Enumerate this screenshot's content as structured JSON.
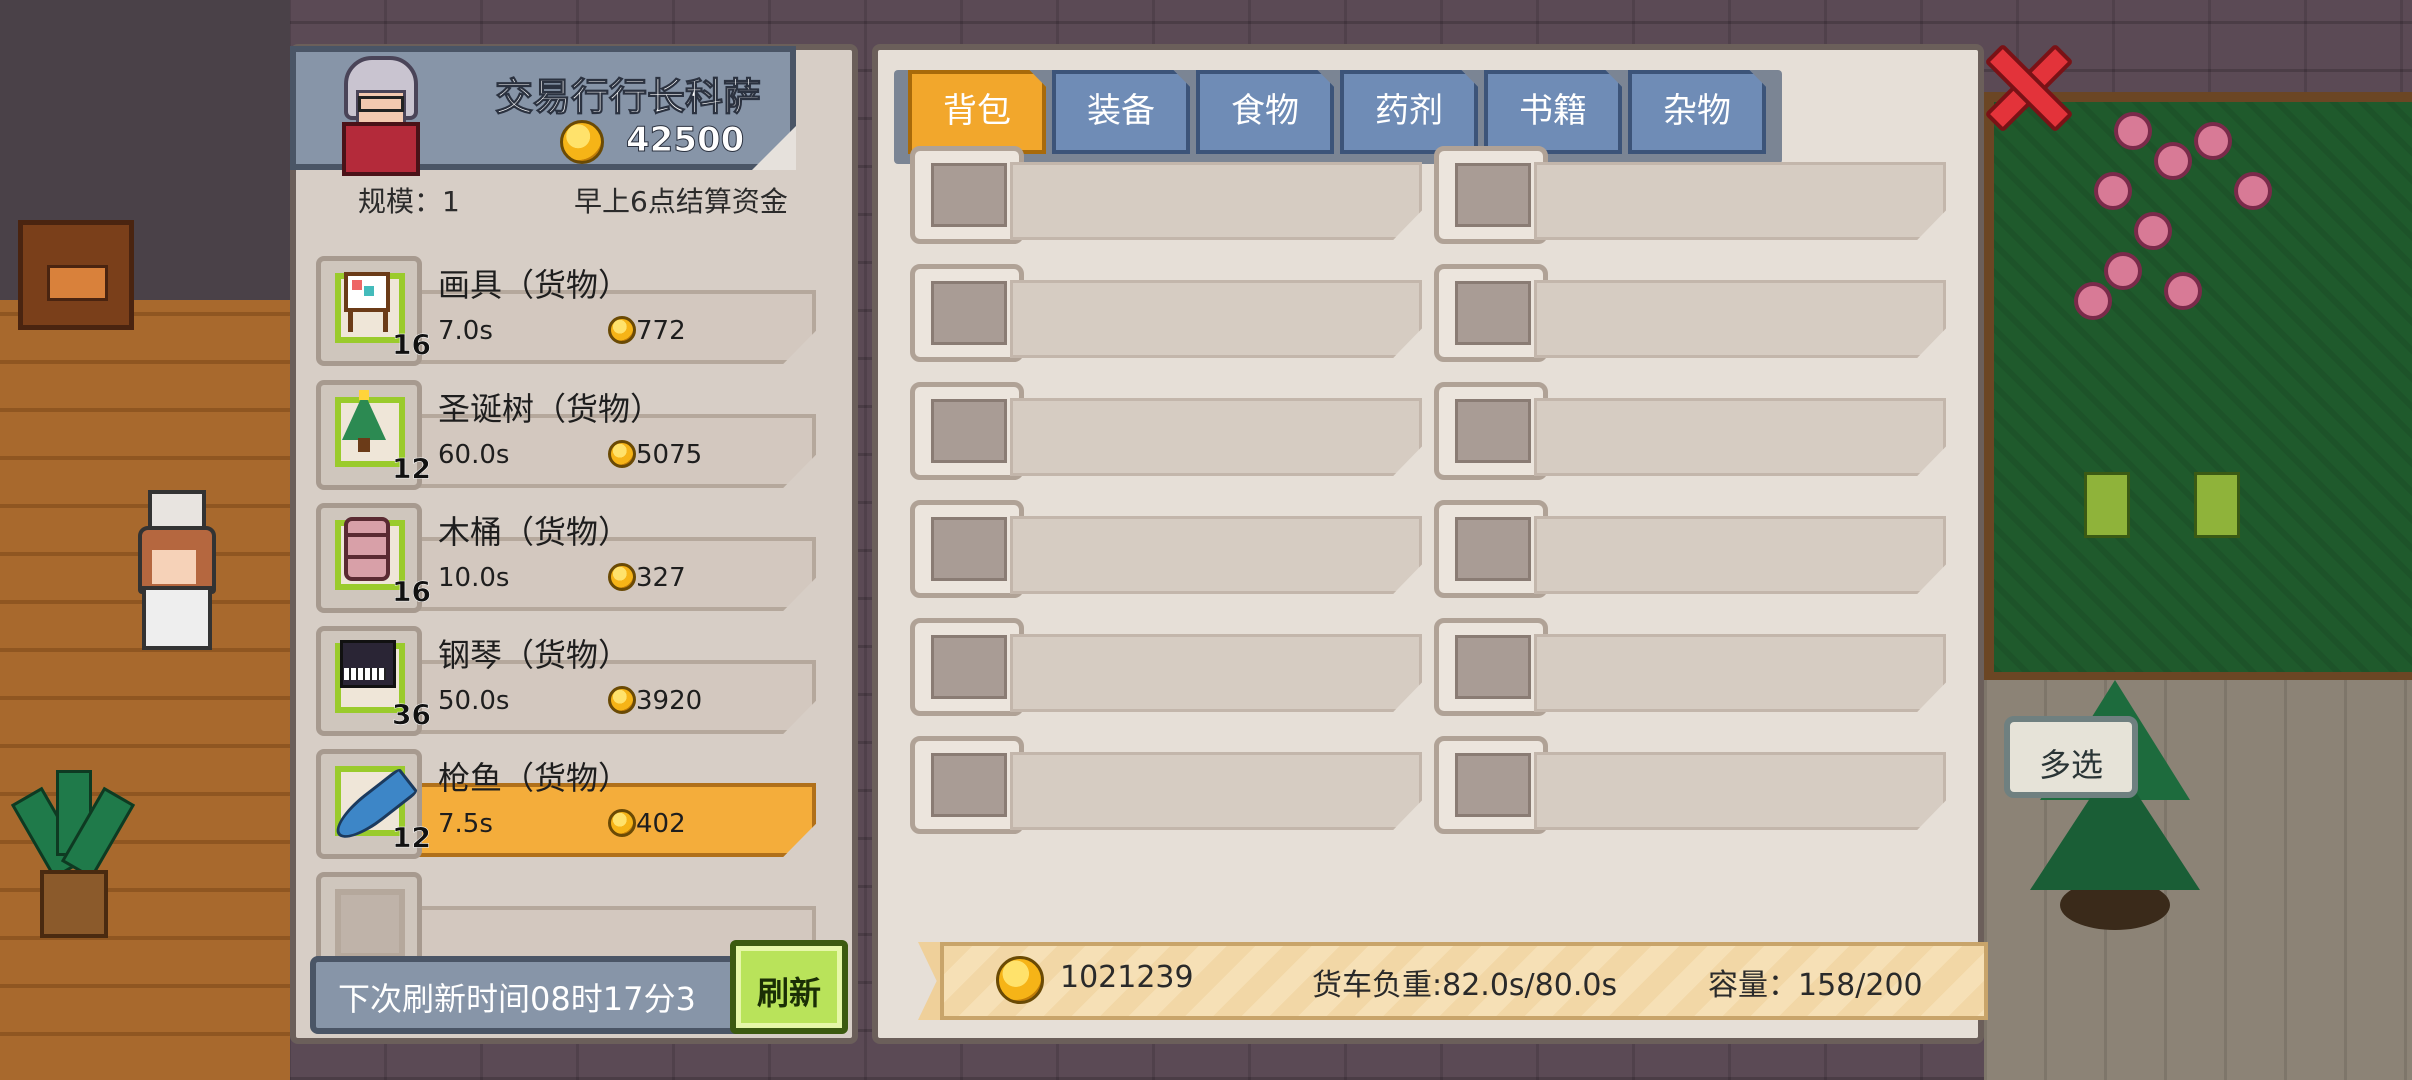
{
  "trader": {
    "name": "交易行行长科萨",
    "money": "42500",
    "scale_label": "规模：1",
    "settle_note": "早上6点结算资金"
  },
  "goods": [
    {
      "name": "画具（货物）",
      "qty": "16",
      "time": "7.0s",
      "price": "772",
      "icon": "easel-icon",
      "selected": false
    },
    {
      "name": "圣诞树（货物）",
      "qty": "12",
      "time": "60.0s",
      "price": "5075",
      "icon": "christmas-tree-icon",
      "selected": false
    },
    {
      "name": "木桶（货物）",
      "qty": "16",
      "time": "10.0s",
      "price": "327",
      "icon": "barrel-icon",
      "selected": false
    },
    {
      "name": "钢琴（货物）",
      "qty": "36",
      "time": "50.0s",
      "price": "3920",
      "icon": "piano-icon",
      "selected": false
    },
    {
      "name": "枪鱼（货物）",
      "qty": "12",
      "time": "7.5s",
      "price": "402",
      "icon": "tuna-icon",
      "selected": true
    }
  ],
  "refresh": {
    "next_time": "下次刷新时间08时17分3",
    "button_label": "刷新"
  },
  "tabs": [
    {
      "label": "背包",
      "active": true
    },
    {
      "label": "装备",
      "active": false
    },
    {
      "label": "食物",
      "active": false
    },
    {
      "label": "药剂",
      "active": false
    },
    {
      "label": "书籍",
      "active": false
    },
    {
      "label": "杂物",
      "active": false
    }
  ],
  "footer": {
    "money": "1021239",
    "load": "货车负重:82.0s/80.0s",
    "capacity": "容量：158/200"
  },
  "multi_select_label": "多选",
  "colors": {
    "tab_active": "#f2a72c",
    "tab_inactive": "#6f8cb6",
    "selected_item": "#f4ad3b",
    "close": "#e3333a"
  }
}
